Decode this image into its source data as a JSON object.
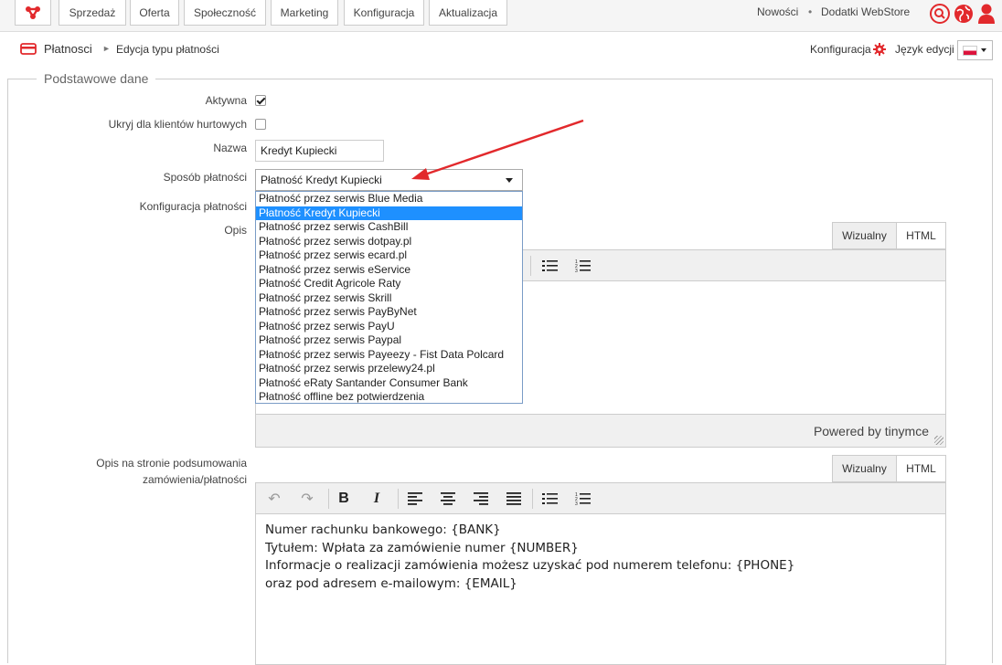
{
  "topnav": {
    "items": [
      "Sprzedaż",
      "Oferta",
      "Społeczność",
      "Marketing",
      "Konfiguracja",
      "Aktualizacja"
    ],
    "news_label": "Nowości",
    "separator": "•",
    "addons_label": "Dodatki WebStore",
    "icons": [
      "search-icon",
      "globe-icon",
      "user-icon"
    ],
    "accent_color": "#e2292c"
  },
  "breadcrumb": {
    "section": "Płatnosci",
    "separator": "►",
    "page": "Edycja typu płatności"
  },
  "header_right": {
    "config_label": "Konfiguracja",
    "lang_label": "Język edycji",
    "lang_flag": "pl"
  },
  "form": {
    "legend": "Podstawowe dane",
    "active_label": "Aktywna",
    "active_checked": true,
    "hide_label": "Ukryj dla klientów hurtowych",
    "hide_checked": false,
    "name_label": "Nazwa",
    "name_value": "Kredyt Kupiecki",
    "method_label": "Sposób płatności",
    "method_value": "Płatność Kredyt Kupiecki",
    "method_options": [
      "Płatność przez serwis Blue Media",
      "Płatność Kredyt Kupiecki",
      "Płatność przez serwis CashBill",
      "Płatność przez serwis dotpay.pl",
      "Płatność przez serwis ecard.pl",
      "Płatność przez serwis eService",
      "Płatność Credit Agricole Raty",
      "Płatność przez serwis Skrill",
      "Płatność przez serwis PayByNet",
      "Płatność przez serwis PayU",
      "Płatność przez serwis Paypal",
      "Płatność przez serwis Payeezy - Fist Data Polcard",
      "Płatność przez serwis przelewy24.pl",
      "Płatność eRaty Santander Consumer Bank",
      "Płatność offline bez potwierdzenia"
    ],
    "method_selected_index": 1,
    "config_label": "Konfiguracja płatności",
    "desc_label": "Opis",
    "summary_label_line1": "Opis na stronie podsumowania",
    "summary_label_line2": "zamówienia/płatności"
  },
  "editor": {
    "tab_visual": "Wizualny",
    "tab_html": "HTML",
    "powered_by": "Powered by tinymce",
    "summary_lines": [
      "Numer rachunku bankowego: {BANK}",
      "Tytułem: Wpłata za zamówienie numer {NUMBER}",
      "Informacje o realizacji zamówienia możesz uzyskać pod numerem telefonu: {PHONE}",
      "oraz pod adresem e-mailowym: {EMAIL}"
    ]
  },
  "annotation": {
    "arrow_color": "#e2292c"
  }
}
